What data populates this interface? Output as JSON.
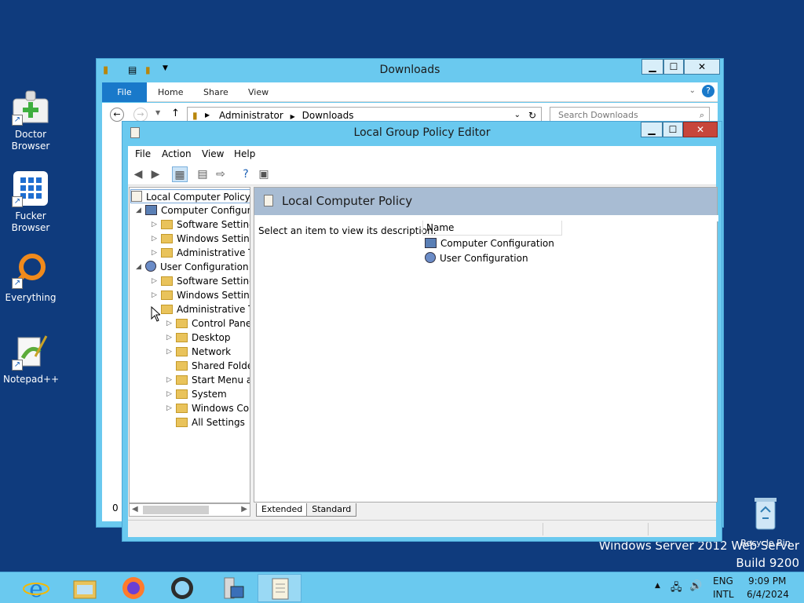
{
  "desktop": {
    "icons": [
      {
        "label1": "Doctor",
        "label2": "Browser"
      },
      {
        "label1": "Fucker",
        "label2": "Browser"
      },
      {
        "label1": "Everything",
        "label2": ""
      },
      {
        "label1": "Notepad++",
        "label2": ""
      }
    ],
    "recycle_bin": "Recycle Bin",
    "watermark": {
      "line1": "Windows Server 2012 Web Server",
      "line2": "Build 9200"
    }
  },
  "explorer": {
    "title": "Downloads",
    "ribbon_tabs": [
      "File",
      "Home",
      "Share",
      "View"
    ],
    "address": {
      "part1": "Administrator",
      "part2": "Downloads"
    },
    "search_placeholder": "Search Downloads",
    "side_char": "0"
  },
  "gpe": {
    "title": "Local Group Policy Editor",
    "menu": [
      "File",
      "Action",
      "View",
      "Help"
    ],
    "tree": {
      "root": "Local Computer Policy",
      "computer_config": "Computer Configura",
      "cc_children": [
        "Software Settings",
        "Windows Setting",
        "Administrative Te"
      ],
      "user_config": "User Configuration",
      "uc_children": [
        "Software Settings",
        "Windows Setting",
        "Administrative Te"
      ],
      "admin_children": [
        "Control Panel",
        "Desktop",
        "Network",
        "Shared Folder",
        "Start Menu ar",
        "System",
        "Windows Cor",
        "All Settings"
      ]
    },
    "right": {
      "header": "Local Computer Policy",
      "description": "Select an item to view its description.",
      "column_name": "Name",
      "items": [
        "Computer Configuration",
        "User Configuration"
      ]
    },
    "tabs": [
      "Extended",
      "Standard"
    ]
  },
  "taskbar": {
    "tray": {
      "lang1": "ENG",
      "lang2": "INTL",
      "time": "9:09 PM",
      "date": "6/4/2024"
    }
  },
  "colors": {
    "desktop": "#0f3b7d",
    "window_frame": "#6ac9ef",
    "close_button": "#c7463b",
    "folder": "#e9c35b"
  }
}
